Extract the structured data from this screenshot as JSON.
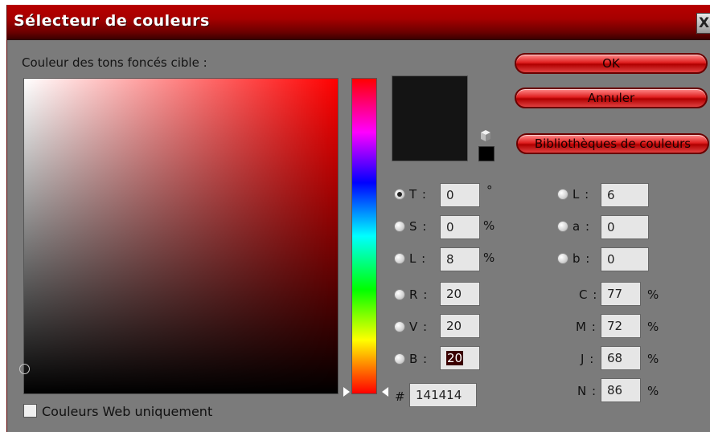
{
  "window": {
    "title": "Sélecteur de couleurs",
    "close_glyph": "X"
  },
  "target_label": "Couleur des tons foncés cible :",
  "buttons": {
    "ok": "OK",
    "cancel": "Annuler",
    "libraries": "Bibliothèques de couleurs"
  },
  "current_color_hex": "#141414",
  "hsb": [
    {
      "label": "T :",
      "value": "0",
      "unit": "°",
      "selected": true
    },
    {
      "label": "S :",
      "value": "0",
      "unit": "%",
      "selected": false
    },
    {
      "label": "L :",
      "value": "8",
      "unit": "%",
      "selected": false
    }
  ],
  "rgb": [
    {
      "label": "R :",
      "value": "20"
    },
    {
      "label": "V :",
      "value": "20"
    },
    {
      "label": "B :",
      "value": "20"
    }
  ],
  "lab": [
    {
      "label": "L :",
      "value": "6"
    },
    {
      "label": "a :",
      "value": "0"
    },
    {
      "label": "b :",
      "value": "0"
    }
  ],
  "cmjn": [
    {
      "label": "C :",
      "value": "77",
      "unit": "%"
    },
    {
      "label": "M :",
      "value": "72",
      "unit": "%"
    },
    {
      "label": "J :",
      "value": "68",
      "unit": "%"
    },
    {
      "label": "N :",
      "value": "86",
      "unit": "%"
    }
  ],
  "hex": {
    "prefix": "#",
    "value": "141414"
  },
  "web_only_label": "Couleurs Web uniquement",
  "web_only_checked": false
}
